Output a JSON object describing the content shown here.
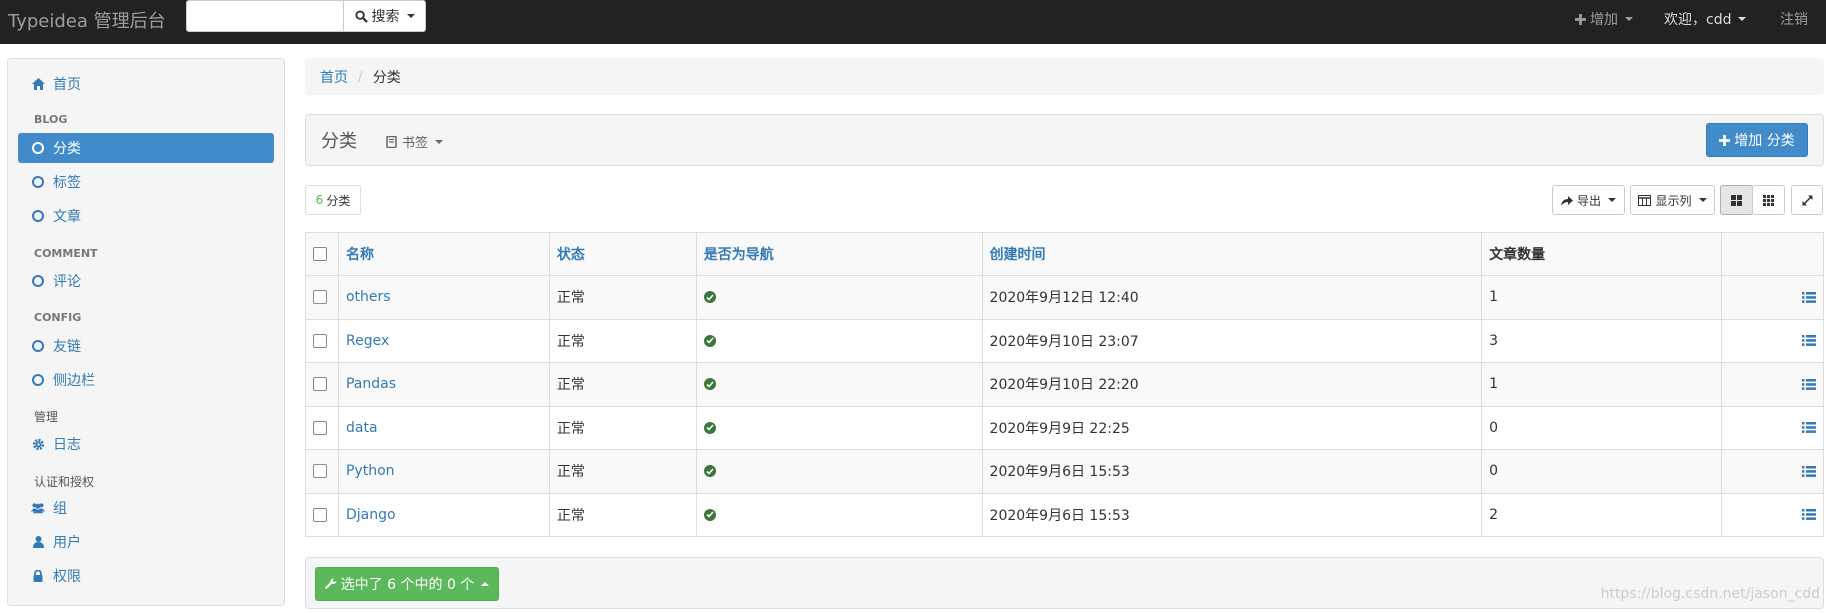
{
  "app": {
    "title": "Typeidea 管理后台"
  },
  "navbar": {
    "search_placeholder": "",
    "search_label": "搜索",
    "add_label": "增加",
    "welcome_label": "欢迎，cdd",
    "logout_label": "注销"
  },
  "sidebar": {
    "home": "首页",
    "sections": {
      "blog": "BLOG",
      "comment": "COMMENT",
      "config": "CONFIG",
      "manage": "管理",
      "auth": "认证和授权"
    },
    "items": {
      "category": "分类",
      "tag": "标签",
      "post": "文章",
      "comment": "评论",
      "link": "友链",
      "sidebar": "侧边栏",
      "log": "日志",
      "group": "组",
      "user": "用户",
      "permission": "权限"
    }
  },
  "breadcrumb": {
    "home": "首页",
    "current": "分类"
  },
  "header": {
    "title": "分类",
    "bookmark_label": "书签",
    "add_button": "增加 分类"
  },
  "toolbar": {
    "count": "6",
    "count_label": "分类",
    "export_label": "导出",
    "columns_label": "显示列"
  },
  "table": {
    "columns": [
      "名称",
      "状态",
      "是否为导航",
      "创建时间",
      "文章数量"
    ],
    "rows": [
      {
        "name": "others",
        "status": "正常",
        "created": "2020年9月12日 12:40",
        "count": "1"
      },
      {
        "name": "Regex",
        "status": "正常",
        "created": "2020年9月10日 23:07",
        "count": "3"
      },
      {
        "name": "Pandas",
        "status": "正常",
        "created": "2020年9月10日 22:20",
        "count": "1"
      },
      {
        "name": "data",
        "status": "正常",
        "created": "2020年9月9日 22:25",
        "count": "0"
      },
      {
        "name": "Python",
        "status": "正常",
        "created": "2020年9月6日 15:53",
        "count": "0"
      },
      {
        "name": "Django",
        "status": "正常",
        "created": "2020年9月6日 15:53",
        "count": "2"
      }
    ]
  },
  "footer": {
    "action_label": "选中了 6 个中的 0 个"
  },
  "watermark": "https://blog.csdn.net/jason_cdd",
  "colors": {
    "navbar": "#222222",
    "primary": "#428bca",
    "success": "#5cb85c",
    "link": "#337ab7"
  }
}
